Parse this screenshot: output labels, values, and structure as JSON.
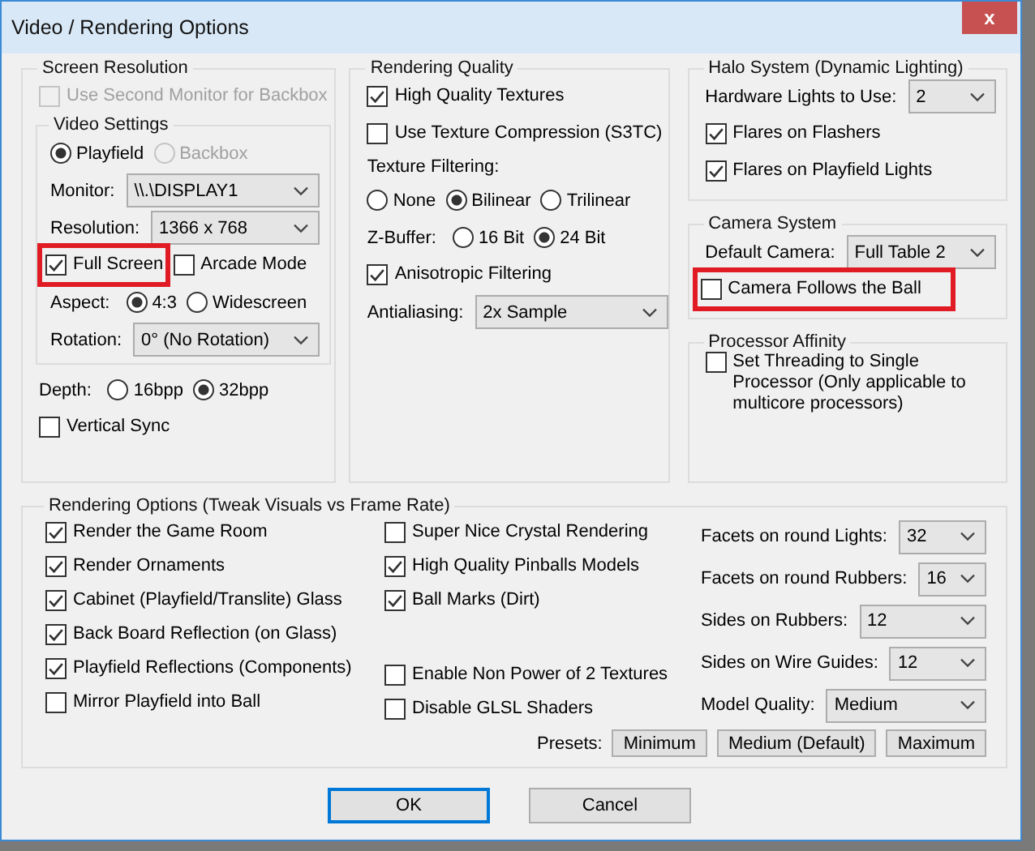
{
  "window": {
    "title": "Video / Rendering Options",
    "close": "x"
  },
  "columns": [
    [
      {
        "title": "Screen Resolution",
        "rows": [
          {
            "kind": "checkbox",
            "label": "Use Second Monitor for Backbox",
            "checked": false,
            "disabled": true,
            "highlighted": false
          },
          {
            "kind": "group",
            "title": "Video Settings",
            "rows": [
              {
                "kind": "radios",
                "options": [
                  {
                    "label": "Playfield",
                    "selected": true,
                    "disabled": false
                  },
                  {
                    "label": "Backbox",
                    "selected": false,
                    "disabled": true
                  }
                ]
              },
              {
                "kind": "select",
                "label": "Monitor:",
                "value": "\\\\.\\DISPLAY1"
              },
              {
                "kind": "select",
                "label": "Resolution:",
                "value": "1366 x 768"
              },
              {
                "kind": "pair",
                "items": [
                  {
                    "kind": "checkbox",
                    "label": "Full Screen",
                    "checked": true,
                    "disabled": false,
                    "highlighted": true
                  },
                  {
                    "kind": "checkbox",
                    "label": "Arcade Mode",
                    "checked": false,
                    "disabled": false,
                    "highlighted": false
                  }
                ]
              },
              {
                "kind": "radios",
                "label": "Aspect:",
                "options": [
                  {
                    "label": "4:3",
                    "selected": true,
                    "disabled": false
                  },
                  {
                    "label": "Widescreen",
                    "selected": false,
                    "disabled": false
                  }
                ]
              },
              {
                "kind": "select",
                "label": "Rotation:",
                "value": "0° (No Rotation)"
              }
            ]
          },
          {
            "kind": "radios",
            "label": "Depth:",
            "options": [
              {
                "label": "16bpp",
                "selected": false,
                "disabled": false
              },
              {
                "label": "32bpp",
                "selected": true,
                "disabled": false
              }
            ]
          },
          {
            "kind": "checkbox",
            "label": "Vertical Sync",
            "checked": false,
            "disabled": false,
            "highlighted": false
          }
        ]
      }
    ],
    [
      {
        "title": "Rendering Quality",
        "rows": [
          {
            "kind": "checkbox",
            "label": "High Quality Textures",
            "checked": true,
            "disabled": false,
            "highlighted": false
          },
          {
            "kind": "checkbox",
            "label": "Use Texture Compression (S3TC)",
            "checked": false,
            "disabled": false,
            "highlighted": false
          },
          {
            "kind": "note",
            "text": "Texture Filtering:"
          },
          {
            "kind": "radios",
            "options": [
              {
                "label": "None",
                "selected": false,
                "disabled": false
              },
              {
                "label": "Bilinear",
                "selected": true,
                "disabled": false
              },
              {
                "label": "Trilinear",
                "selected": false,
                "disabled": false
              }
            ]
          },
          {
            "kind": "radios",
            "label": "Z-Buffer:",
            "options": [
              {
                "label": "16 Bit",
                "selected": false,
                "disabled": false
              },
              {
                "label": "24 Bit",
                "selected": true,
                "disabled": false
              }
            ]
          },
          {
            "kind": "checkbox",
            "label": "Anisotropic Filtering",
            "checked": true,
            "disabled": false,
            "highlighted": false
          },
          {
            "kind": "select",
            "label": "Antialiasing:",
            "value": "2x Sample"
          }
        ]
      }
    ],
    [
      {
        "title": "Halo System (Dynamic Lighting)",
        "rows": [
          {
            "kind": "select",
            "label": "Hardware Lights to Use:",
            "value": "2"
          },
          {
            "kind": "checkbox",
            "label": "Flares on Flashers",
            "checked": true,
            "disabled": false,
            "highlighted": false
          },
          {
            "kind": "checkbox",
            "label": "Flares on Playfield Lights",
            "checked": true,
            "disabled": false,
            "highlighted": false
          }
        ]
      },
      {
        "title": "Camera System",
        "rows": [
          {
            "kind": "select",
            "label": "Default Camera:",
            "value": "Full Table 2"
          },
          {
            "kind": "checkbox",
            "label": "Camera Follows the Ball",
            "checked": false,
            "disabled": false,
            "highlighted": true
          }
        ]
      },
      {
        "title": "Processor Affinity",
        "rows": [
          {
            "kind": "checkbox",
            "label": "Set Threading to Single Processor (Only applicable to multicore processors)",
            "checked": false,
            "disabled": false,
            "highlighted": false
          }
        ]
      }
    ]
  ],
  "rendering_options": {
    "title": "Rendering Options (Tweak Visuals vs Frame Rate)",
    "checks_left": [
      {
        "label": "Render the Game Room",
        "checked": true
      },
      {
        "label": "Render Ornaments",
        "checked": true
      },
      {
        "label": "Cabinet (Playfield/Translite) Glass",
        "checked": true
      },
      {
        "label": "Back Board Reflection (on Glass)",
        "checked": true
      },
      {
        "label": "Playfield Reflections (Components)",
        "checked": true
      },
      {
        "label": "Mirror Playfield into Ball",
        "checked": false
      }
    ],
    "checks_middle_top": [
      {
        "label": "Super Nice Crystal Rendering",
        "checked": false
      },
      {
        "label": "High Quality Pinballs Models",
        "checked": true
      },
      {
        "label": "Ball Marks (Dirt)",
        "checked": true
      }
    ],
    "checks_middle_bottom": [
      {
        "label": "Enable Non Power of 2 Textures",
        "checked": false
      },
      {
        "label": "Disable GLSL Shaders",
        "checked": false
      }
    ],
    "selects": [
      {
        "label": "Facets on round Lights:",
        "value": "32"
      },
      {
        "label": "Facets on round Rubbers:",
        "value": "16"
      },
      {
        "label": "Sides on Rubbers:",
        "value": "12"
      },
      {
        "label": "Sides on Wire Guides:",
        "value": "12"
      },
      {
        "label": "Model Quality:",
        "value": "Medium"
      }
    ],
    "presets": {
      "label": "Presets:",
      "buttons": [
        "Minimum",
        "Medium (Default)",
        "Maximum"
      ]
    }
  },
  "buttons": [
    {
      "label": "OK",
      "default": true
    },
    {
      "label": "Cancel",
      "default": false
    }
  ]
}
